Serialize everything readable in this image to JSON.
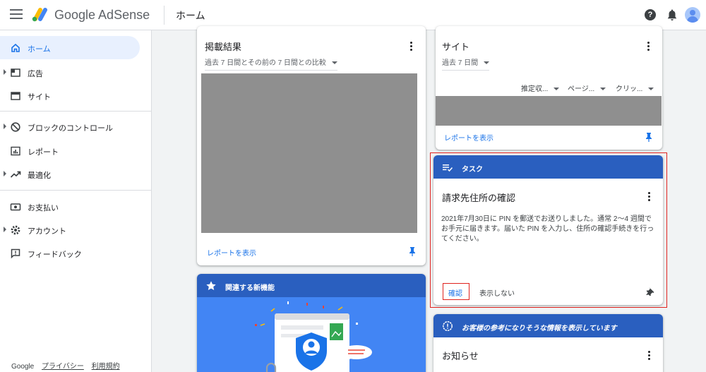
{
  "header": {
    "brand": "Google AdSense",
    "page_title": "ホーム",
    "help_glyph": "?"
  },
  "sidebar": {
    "items": [
      {
        "label": "ホーム",
        "icon": "home-icon",
        "active": true
      },
      {
        "label": "広告",
        "icon": "ads-icon"
      },
      {
        "label": "サイト",
        "icon": "sites-icon"
      },
      {
        "label": "ブロックのコントロール",
        "icon": "block-icon"
      },
      {
        "label": "レポート",
        "icon": "reports-icon"
      },
      {
        "label": "最適化",
        "icon": "optimization-icon"
      },
      {
        "label": "お支払い",
        "icon": "payments-icon"
      },
      {
        "label": "アカウント",
        "icon": "account-settings-icon"
      },
      {
        "label": "フィードバック",
        "icon": "feedback-icon"
      }
    ],
    "footer": {
      "google": "Google",
      "privacy": "プライバシー",
      "terms": "利用規約"
    }
  },
  "performance_card": {
    "title": "掲載結果",
    "date_range": "過去 7 日間とその前の 7 日間との比較",
    "report_link": "レポートを表示"
  },
  "features_card": {
    "banner_title": "関連する新機能"
  },
  "sites_card": {
    "title": "サイト",
    "date_range": "過去 7 日間",
    "columns": [
      "推定収...",
      "ページ...",
      "クリッ..."
    ],
    "report_link": "レポートを表示"
  },
  "task_card": {
    "banner_title": "タスク",
    "title": "請求先住所の確認",
    "body": "2021年7月30日に PIN を郵送でお送りしました。通常 2〜4 週間でお手元に届きます。届いた PIN を入力し、住所の確認手続きを行ってください。",
    "confirm_button": "確認",
    "dismiss_button": "表示しない"
  },
  "info_card": {
    "banner_title": "お客様の参考になりそうな情報を表示しています",
    "title": "お知らせ"
  },
  "colors": {
    "primary_blue": "#1a73e8",
    "banner_blue": "#2a5fbf",
    "highlight_red": "#e0221e",
    "placeholder_gray": "#8f8f8f"
  }
}
